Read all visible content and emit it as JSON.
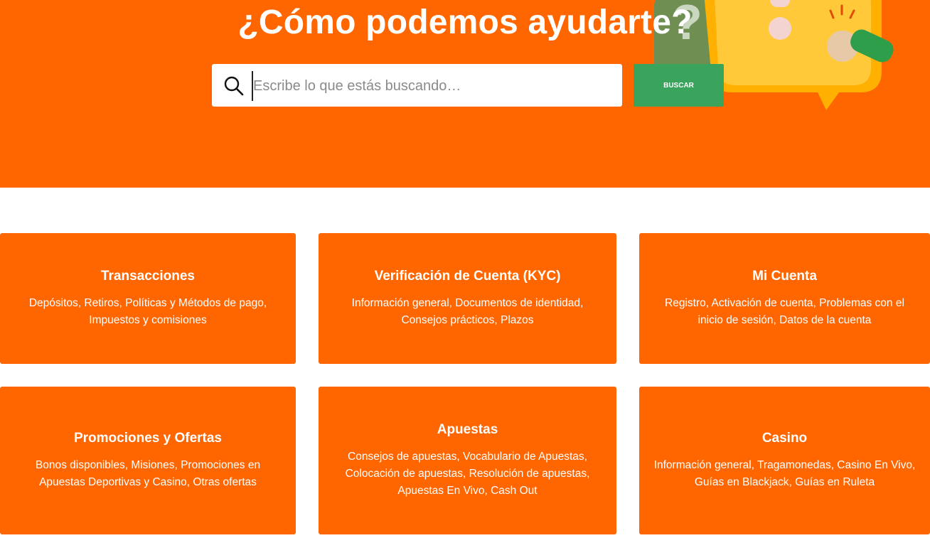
{
  "hero": {
    "title": "¿Cómo podemos ayudarte?",
    "search_placeholder": "Escribe lo que estás buscando…",
    "search_button": "BUSCAR"
  },
  "colors": {
    "brand_orange": "#ff6600",
    "button_green": "#3aa45c",
    "text_white": "#ffffff"
  },
  "categories": [
    {
      "title": "Transacciones",
      "description": "Depósitos, Retiros, Políticas y Métodos de pago, Impuestos y comisiones"
    },
    {
      "title": "Verificación de Cuenta (KYC)",
      "description": "Información general, Documentos de identidad, Consejos prácticos, Plazos"
    },
    {
      "title": "Mi Cuenta",
      "description": "Registro, Activación de cuenta, Problemas con el inicio de sesión, Datos de la cuenta"
    },
    {
      "title": "Promociones y Ofertas",
      "description": "Bonos disponibles, Misiones, Promociones en Apuestas Deportivas y Casino, Otras ofertas"
    },
    {
      "title": "Apuestas",
      "description": "Consejos de apuestas, Vocabulario de Apuestas, Colocación de apuestas, Resolución de apuestas, Apuestas En Vivo, Cash Out"
    },
    {
      "title": "Casino",
      "description": "Información general, Tragamonedas, Casino En Vivo, Guías en Blackjack, Guías en Ruleta"
    }
  ]
}
